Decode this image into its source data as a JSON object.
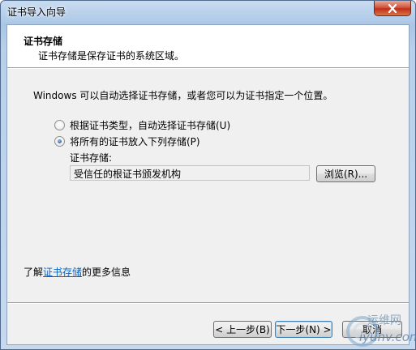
{
  "window": {
    "title": "证书导入向导"
  },
  "header": {
    "title": "证书存储",
    "subtitle": "证书存储是保存证书的系统区域。"
  },
  "body": {
    "description": "Windows 可以自动选择证书存储，或者您可以为证书指定一个位置。",
    "options": [
      {
        "label": "根据证书类型，自动选择证书存储(U)",
        "checked": false
      },
      {
        "label": "将所有的证书放入下列存储(P)",
        "checked": true
      }
    ],
    "store_label": "证书存储:",
    "store_value": "受信任的根证书颁发机构",
    "browse_label": "浏览(R)..."
  },
  "more_info": {
    "prefix": "了解",
    "link": "证书存储",
    "suffix": "的更多信息"
  },
  "buttons": {
    "back": "< 上一步(B)",
    "next": "下一步(N) >",
    "cancel": "取消"
  },
  "watermark": {
    "line1": "运维网",
    "line2": "iyunv.com"
  },
  "colors": {
    "link": "#0066cc",
    "close_button": "#c22f17",
    "title_bar": "#aac6e6"
  },
  "icons": {
    "close": "close-icon",
    "radio_checked": "radio-checked-icon",
    "radio_unchecked": "radio-unchecked-icon"
  }
}
